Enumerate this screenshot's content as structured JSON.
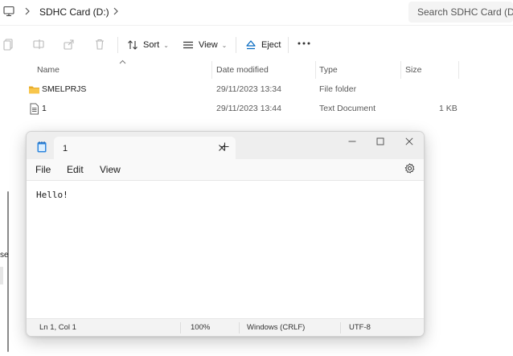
{
  "explorer": {
    "breadcrumb": {
      "segment": "SDHC Card (D:)"
    },
    "search": {
      "placeholder": "Search SDHC Card (D:)"
    },
    "command_bar": {
      "sort_label": "Sort",
      "view_label": "View",
      "eject_label": "Eject"
    },
    "left_pane": {
      "fragment": "se"
    },
    "columns": {
      "name": "Name",
      "date_modified": "Date modified",
      "type": "Type",
      "size": "Size"
    },
    "files": [
      {
        "name": "SMELPRJS",
        "date": "29/11/2023 13:34",
        "type": "File folder",
        "size": "",
        "icon": "folder-icon"
      },
      {
        "name": "1",
        "date": "29/11/2023 13:44",
        "type": "Text Document",
        "size": "1 KB",
        "icon": "text-file-icon"
      }
    ],
    "accent": "#0067c0",
    "folder_color": "#f8c64c"
  },
  "notepad": {
    "tab_title": "1",
    "menu": {
      "file": "File",
      "edit": "Edit",
      "view": "View"
    },
    "content": "Hello!",
    "status": {
      "position": "Ln 1, Col 1",
      "zoom": "100%",
      "line_ending": "Windows (CRLF)",
      "encoding": "UTF-8"
    },
    "accent": "#2e86de"
  }
}
